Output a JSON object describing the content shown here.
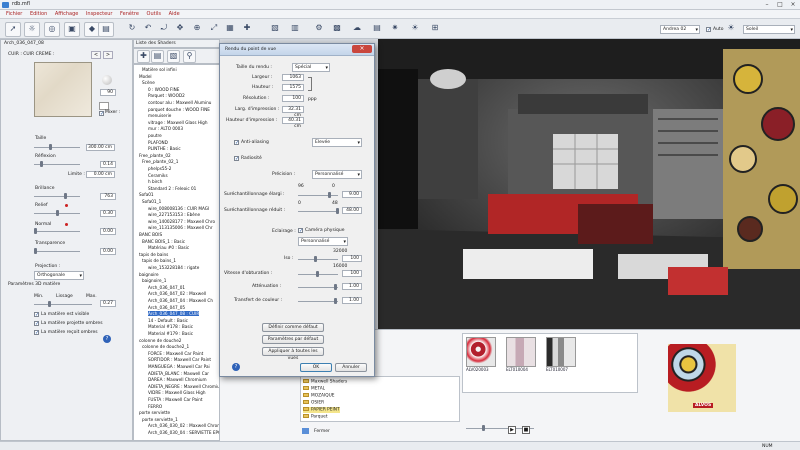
{
  "window": {
    "title": "rdb.mfl"
  },
  "menu": [
    "Fichier",
    "Edition",
    "Affichage",
    "Inspecteur",
    "Fenêtre",
    "Outils",
    "Aide"
  ],
  "toolbar": {
    "camera_combo": "Andrea 02",
    "auto_label": "Auto",
    "sun_combo": "Soleil"
  },
  "material_panel": {
    "header": "Arch_036_047_08",
    "name": "CUIR : CUIR CREME :",
    "value_90": "90",
    "mixer_label": "Mixer :",
    "taille_label": "Taille",
    "taille_value": "300.00 cm",
    "reflexion_label": "Réflexion",
    "reflexion_value": "0.14",
    "limite_label": "Limite :",
    "limite_value": "0.00 cm",
    "brillance_label": "Brillance",
    "brillance_value": "763",
    "relief_label": "Relief",
    "relief_value": "0.30",
    "normal_label": "Normal",
    "normal_value": "0.00",
    "transparence_label": "Transparence",
    "transparence_value": "0.00",
    "projection_label": "Projection :",
    "projection_value": "Orthogonale",
    "parametres_3d_label": "Paramètres 3D matière",
    "min_label": "Min.",
    "lissage_label": "Lissage",
    "max_label": "Max.",
    "lissage_value": "0.27",
    "cb_visible": "La matière est visible",
    "cb_projette": "La matière projette ombres",
    "cb_recoit": "La matière reçoit ombres",
    "help": "?"
  },
  "shader_tree": {
    "header": "Liste des Shaders",
    "rows": [
      {
        "t": "Matière sol infini",
        "i": 2
      },
      {
        "t": "Model",
        "i": 1
      },
      {
        "t": "Scène",
        "i": 2
      },
      {
        "t": "0 : WOOD FINE",
        "i": 4
      },
      {
        "t": "Parquet : WOOD2",
        "i": 4
      },
      {
        "t": "contour alu : Maxwell Aluminu",
        "i": 4
      },
      {
        "t": "parquet douche : WOOD FINE",
        "i": 4
      },
      {
        "t": "menuiserie",
        "i": 4
      },
      {
        "t": "vitrage : Maxwell Glass High",
        "i": 4
      },
      {
        "t": "mur : ALTO 0003",
        "i": 4
      },
      {
        "t": "poutre",
        "i": 4
      },
      {
        "t": "PLAFOND",
        "i": 4
      },
      {
        "t": "PLINTHE : Basic",
        "i": 4
      },
      {
        "t": "Free_plante_02",
        "i": 1
      },
      {
        "t": "Free_plante_02_1",
        "i": 2
      },
      {
        "t": "phelps55-2",
        "i": 4
      },
      {
        "t": "Ceramiks",
        "i": 4
      },
      {
        "t": "h birch",
        "i": 4
      },
      {
        "t": "Standard 2 : Feleoic 01",
        "i": 4
      },
      {
        "t": "Sofa01",
        "i": 1
      },
      {
        "t": "Sofa01_1",
        "i": 2
      },
      {
        "t": "wire_008008136 : CUIR MAGI",
        "i": 4
      },
      {
        "t": "wire_227153153 : Ebène",
        "i": 4
      },
      {
        "t": "wire_140028177 : Maxwell Chro",
        "i": 4
      },
      {
        "t": "wire_113135006 : Maxwell Chr",
        "i": 4
      },
      {
        "t": "BANC BOIS",
        "i": 1
      },
      {
        "t": "BANC BOIS_1 : Basic",
        "i": 2
      },
      {
        "t": "Matériau #0 : Basic",
        "i": 4
      },
      {
        "t": "tapis de bains",
        "i": 1
      },
      {
        "t": "tapis de bains_1",
        "i": 2
      },
      {
        "t": "wire_153228184 : rigate",
        "i": 4
      },
      {
        "t": "baignoire",
        "i": 1
      },
      {
        "t": "baignoire_1",
        "i": 2
      },
      {
        "t": "Arch_036_047_01",
        "i": 4
      },
      {
        "t": "Arch_036_047_02 : Maxwell",
        "i": 4
      },
      {
        "t": "Arch_036_047_04 : Maxwell Ch",
        "i": 4
      },
      {
        "t": "Arch_036_047_05",
        "i": 4
      },
      {
        "t": "Arch_036_047_08 : CUIR",
        "i": 4,
        "sel": true
      },
      {
        "t": "14 - Default : Basic",
        "i": 4
      },
      {
        "t": "Material #178 : Basic",
        "i": 4
      },
      {
        "t": "Material #179 : Basic",
        "i": 4
      },
      {
        "t": "colonne de douche2",
        "i": 1
      },
      {
        "t": "colonne de douche2_1",
        "i": 2
      },
      {
        "t": "FORCE : Maxwell Car Paint",
        "i": 4
      },
      {
        "t": "SORTIDOR : Maxwell Car Paint",
        "i": 4
      },
      {
        "t": "MANGUEGA : Maxwell Car Pai",
        "i": 4
      },
      {
        "t": "ADIETA_BLANC : Maxwell Car",
        "i": 4
      },
      {
        "t": "DAREA : Maxwell Chromium",
        "i": 4
      },
      {
        "t": "ADIETA_NEGRE : Maxwell Chromium",
        "i": 4
      },
      {
        "t": "VIDRE : Maxwell Glass High",
        "i": 4
      },
      {
        "t": "FUSTA : Maxwell Car Paint",
        "i": 4
      },
      {
        "t": "FERRO",
        "i": 4
      },
      {
        "t": "porte serviette",
        "i": 1
      },
      {
        "t": "porte serviette_1",
        "i": 2
      },
      {
        "t": "Arch_036_030_02 : Maxwell Chromium",
        "i": 4
      },
      {
        "t": "Arch_036_030_04 : SERVIETTE EPONGE3",
        "i": 4
      }
    ]
  },
  "dialog": {
    "title": "Rendu du point de vue",
    "taille_label": "Taille du rendu :",
    "taille_value": "Spécial",
    "largeur_label": "Largeur :",
    "largeur_value": "1063",
    "hauteur_label": "Hauteur :",
    "hauteur_value": "1575",
    "resolution_label": "Résolution :",
    "resolution_value": "100",
    "dpi_unit": "ppp",
    "larg_impression_label": "Larg. d'impression :",
    "larg_impression_value": "32.31 cm",
    "haut_impression_label": "Hauteur d'impression :",
    "haut_impression_value": "40.31 cm",
    "antialias_label": "Anti-aliasing",
    "antialias_value": "Elevée",
    "radiosite_label": "Radiosité",
    "precision_label": "Précision :",
    "precision_value": "Personnalisé",
    "surech_large_label": "Suréchantillonnage élargi :",
    "surech_large_min": "96",
    "surech_large_max": "0",
    "surech_large_value": "9.00",
    "surech_reduit_label": "Suréchantillonnage réduit :",
    "surech_reduit_min": "0",
    "surech_reduit_max": "48",
    "surech_reduit_value": "48.00",
    "eclairage_label": "Eclairage :",
    "camera_physique_label": "Caméra physique",
    "eclairage_value": "Personnalisé",
    "iso_top": "32000",
    "iso_label": "Iso :",
    "iso_value": "100",
    "vitesse_top": "16000",
    "vitesse_label": "Vitesse d'obturation :",
    "vitesse_value": "100",
    "attenuation_label": "Atténuation :",
    "attenuation_value": "1.00",
    "transfert_label": "Transfert de couleur :",
    "transfert_value": "1.00",
    "btn_defaut": "Définir comme défaut",
    "btn_params": "Paramètres par défaut",
    "btn_appliquer": "Appliquer à toutes les vues",
    "btn_ok": "OK",
    "btn_annuler": "Annuler",
    "help": "?"
  },
  "library": {
    "thumbs": [
      {
        "label": "ALV020003"
      },
      {
        "label": "ELT010004"
      },
      {
        "label": "ELT010007"
      }
    ],
    "folders": [
      "Maxwell Shaders",
      "METAL",
      "MOZAIQUE",
      "OSIER",
      "PAPIER PEINT",
      "Parquet"
    ],
    "search_label": "Fermer",
    "preview_brand": "ALVOS"
  },
  "status": {
    "right": "NUM"
  }
}
